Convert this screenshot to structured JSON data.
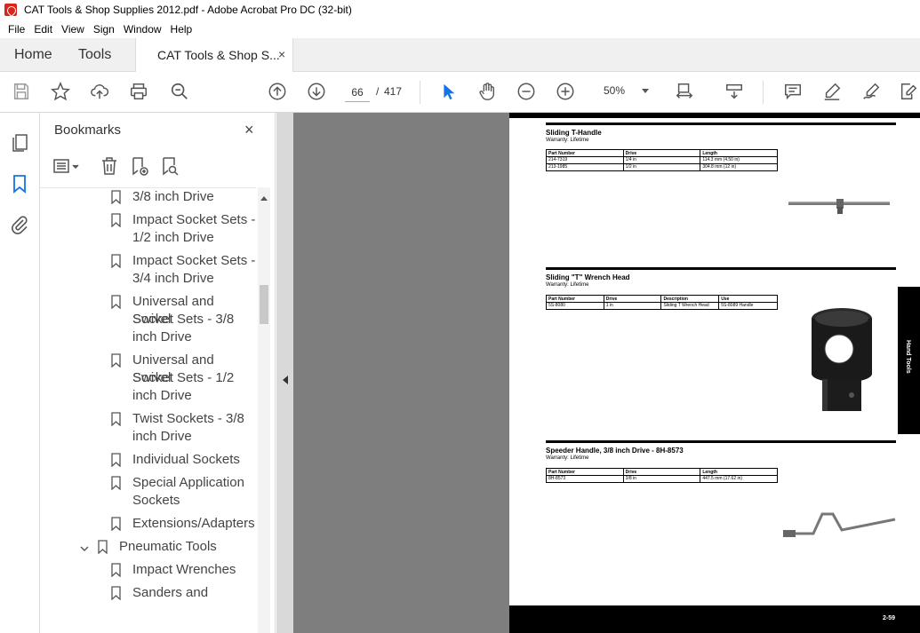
{
  "window": {
    "title": "CAT Tools & Shop Supplies 2012.pdf - Adobe Acrobat Pro DC (32-bit)"
  },
  "menu": [
    "File",
    "Edit",
    "View",
    "Sign",
    "Window",
    "Help"
  ],
  "tabs": {
    "home": "Home",
    "tools": "Tools",
    "document": "CAT Tools & Shop S...",
    "close": "×"
  },
  "toolbar": {
    "icons": [
      "save-icon",
      "star-icon",
      "upload-icon",
      "print-icon",
      "search-zoom-icon",
      "page-up-icon",
      "page-down-icon",
      "select-cursor-icon",
      "hand-icon",
      "zoom-out-icon",
      "zoom-in-icon",
      "page-fit-icon",
      "scroll-mode-icon",
      "comment-icon",
      "highlight-pen-icon",
      "sign-pen-icon",
      "edit-icon"
    ],
    "current_page": "66",
    "page_separator": "/",
    "total_pages": "417",
    "zoom": "50%"
  },
  "bookmarks": {
    "title": "Bookmarks",
    "close": "×",
    "items": [
      {
        "lines": [
          "3/8 inch Drive"
        ],
        "level": 2
      },
      {
        "lines": [
          "Impact Socket Sets -",
          "1/2 inch Drive"
        ],
        "level": 2
      },
      {
        "lines": [
          "Impact Socket Sets -",
          "3/4 inch Drive"
        ],
        "level": 2
      },
      {
        "lines": [
          "Universal and Swivel",
          "Socket Sets - 3/8",
          "inch Drive"
        ],
        "level": 2
      },
      {
        "lines": [
          "Universal and Swivel",
          "Socket Sets - 1/2",
          "inch Drive"
        ],
        "level": 2
      },
      {
        "lines": [
          "Twist Sockets - 3/8",
          "inch Drive"
        ],
        "level": 2
      },
      {
        "lines": [
          "Individual Sockets"
        ],
        "level": 2
      },
      {
        "lines": [
          "Special Application",
          "Sockets"
        ],
        "level": 2
      },
      {
        "lines": [
          "Extensions/Adapters"
        ],
        "level": 2
      },
      {
        "lines": [
          "Pneumatic Tools"
        ],
        "level": 1,
        "expanded": true
      },
      {
        "lines": [
          "Impact Wrenches"
        ],
        "level": 2
      },
      {
        "lines": [
          "Sanders and"
        ],
        "level": 2
      }
    ]
  },
  "document_page": {
    "sections": [
      {
        "title": "Sliding T-Handle",
        "subtitle": "Warranty: Lifetime",
        "headers": [
          "Part Number",
          "Drive",
          "Length"
        ],
        "rows": [
          [
            "214-7319",
            "1/4 in",
            "114.3 mm (4.50 in)"
          ],
          [
            "213-1985",
            "1/2 in",
            "304.8 mm (12 in)"
          ]
        ]
      },
      {
        "title": "Sliding \"T\" Wrench Head",
        "subtitle": "Warranty: Lifetime",
        "headers": [
          "Part Number",
          "Drive",
          "Description",
          "Use"
        ],
        "rows": [
          [
            "5S-8080",
            "1 in",
            "Sliding T Wrench Head",
            "5S-8089 Handle"
          ]
        ]
      },
      {
        "title": "Speeder Handle,  3/8  inch Drive - 8H-8573",
        "subtitle": "Warranty: Lifetime",
        "headers": [
          "Part Number",
          "Drive",
          "Length"
        ],
        "rows": [
          [
            "8H-8573",
            "3/8 in",
            "447.5 mm (17.62 in)"
          ]
        ]
      }
    ],
    "side_tab": "Hand Tools",
    "page_number": "2-59"
  }
}
